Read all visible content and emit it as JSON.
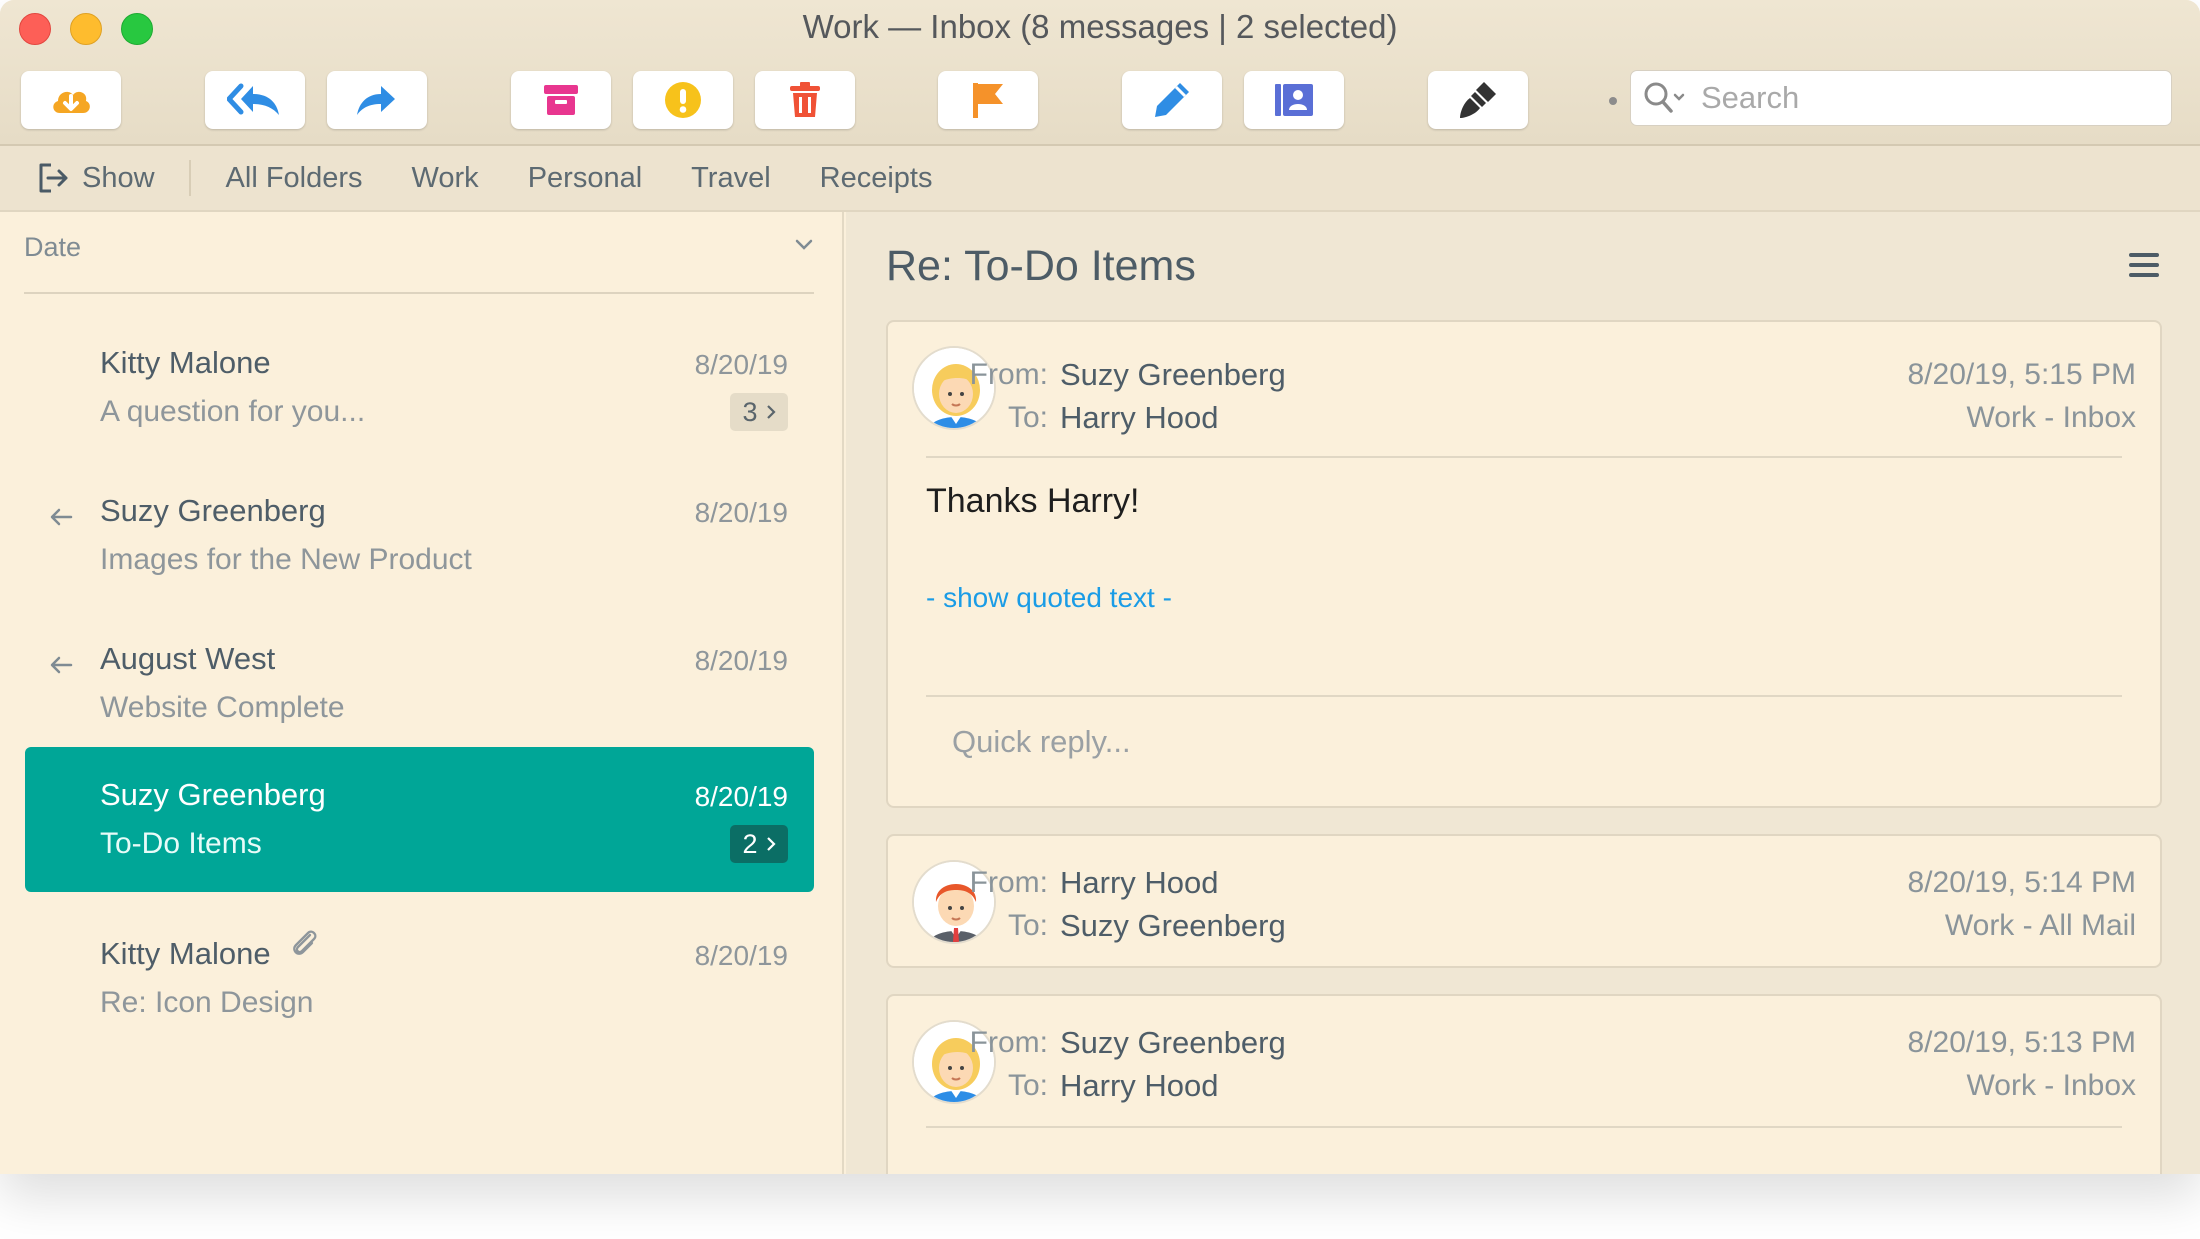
{
  "window": {
    "title": "Work — Inbox (8 messages | 2 selected)"
  },
  "toolbar": {
    "buttons": [
      {
        "name": "get-mail",
        "icon": "cloud-download-icon",
        "color": "#f5a623"
      },
      {
        "name": "reply-all",
        "icon": "reply-all-icon",
        "color": "#2f8de4"
      },
      {
        "name": "forward",
        "icon": "forward-icon",
        "color": "#2f8de4"
      },
      {
        "name": "archive",
        "icon": "archive-icon",
        "color": "#e8368f"
      },
      {
        "name": "junk",
        "icon": "warning-icon",
        "color": "#f7c21b"
      },
      {
        "name": "delete",
        "icon": "trash-icon",
        "color": "#f05236"
      },
      {
        "name": "flag",
        "icon": "flag-icon",
        "color": "#f5922a"
      },
      {
        "name": "compose",
        "icon": "pencil-icon",
        "color": "#2f8de4"
      },
      {
        "name": "contacts",
        "icon": "contacts-icon",
        "color": "#5a6fd6"
      },
      {
        "name": "themes",
        "icon": "paintbrush-icon",
        "color": "#333333"
      }
    ],
    "search_placeholder": "Search"
  },
  "favorites": {
    "show_label": "Show",
    "items": [
      "All Folders",
      "Work",
      "Personal",
      "Travel",
      "Receipts"
    ]
  },
  "message_list": {
    "sort_label": "Date",
    "messages": [
      {
        "sender": "Kitty Malone",
        "date": "8/20/19",
        "subject": "A question for you...",
        "count": "3",
        "replied": false,
        "attachment": false,
        "selected": false
      },
      {
        "sender": "Suzy Greenberg",
        "date": "8/20/19",
        "subject": "Images for the New Product",
        "count": "",
        "replied": true,
        "attachment": false,
        "selected": false
      },
      {
        "sender": "August West",
        "date": "8/20/19",
        "subject": "Website Complete",
        "count": "",
        "replied": true,
        "attachment": false,
        "selected": false
      },
      {
        "sender": "Suzy Greenberg",
        "date": "8/20/19",
        "subject": "To-Do Items",
        "count": "2",
        "replied": false,
        "attachment": false,
        "selected": true
      },
      {
        "sender": "Kitty Malone",
        "date": "8/20/19",
        "subject": "Re: Icon Design",
        "count": "",
        "replied": false,
        "attachment": true,
        "selected": false
      }
    ]
  },
  "reading_pane": {
    "title": "Re: To-Do Items",
    "from_label": "From:",
    "to_label": "To:",
    "cards": [
      {
        "from": "Suzy Greenberg",
        "to": "Harry Hood",
        "datetime": "8/20/19, 5:15 PM",
        "folder": "Work - Inbox",
        "avatar": "female-avatar",
        "body": "Thanks Harry!",
        "quoted_link": "- show quoted text -",
        "quick_reply": "Quick reply..."
      },
      {
        "from": "Harry Hood",
        "to": "Suzy Greenberg",
        "datetime": "8/20/19, 5:14 PM",
        "folder": "Work - All Mail",
        "avatar": "male-avatar"
      },
      {
        "from": "Suzy Greenberg",
        "to": "Harry Hood",
        "datetime": "8/20/19, 5:13 PM",
        "folder": "Work - Inbox",
        "avatar": "female-avatar"
      }
    ]
  },
  "colors": {
    "selection": "#00a697",
    "link": "#1a9ce6",
    "pane_bg": "#fbf0db"
  }
}
